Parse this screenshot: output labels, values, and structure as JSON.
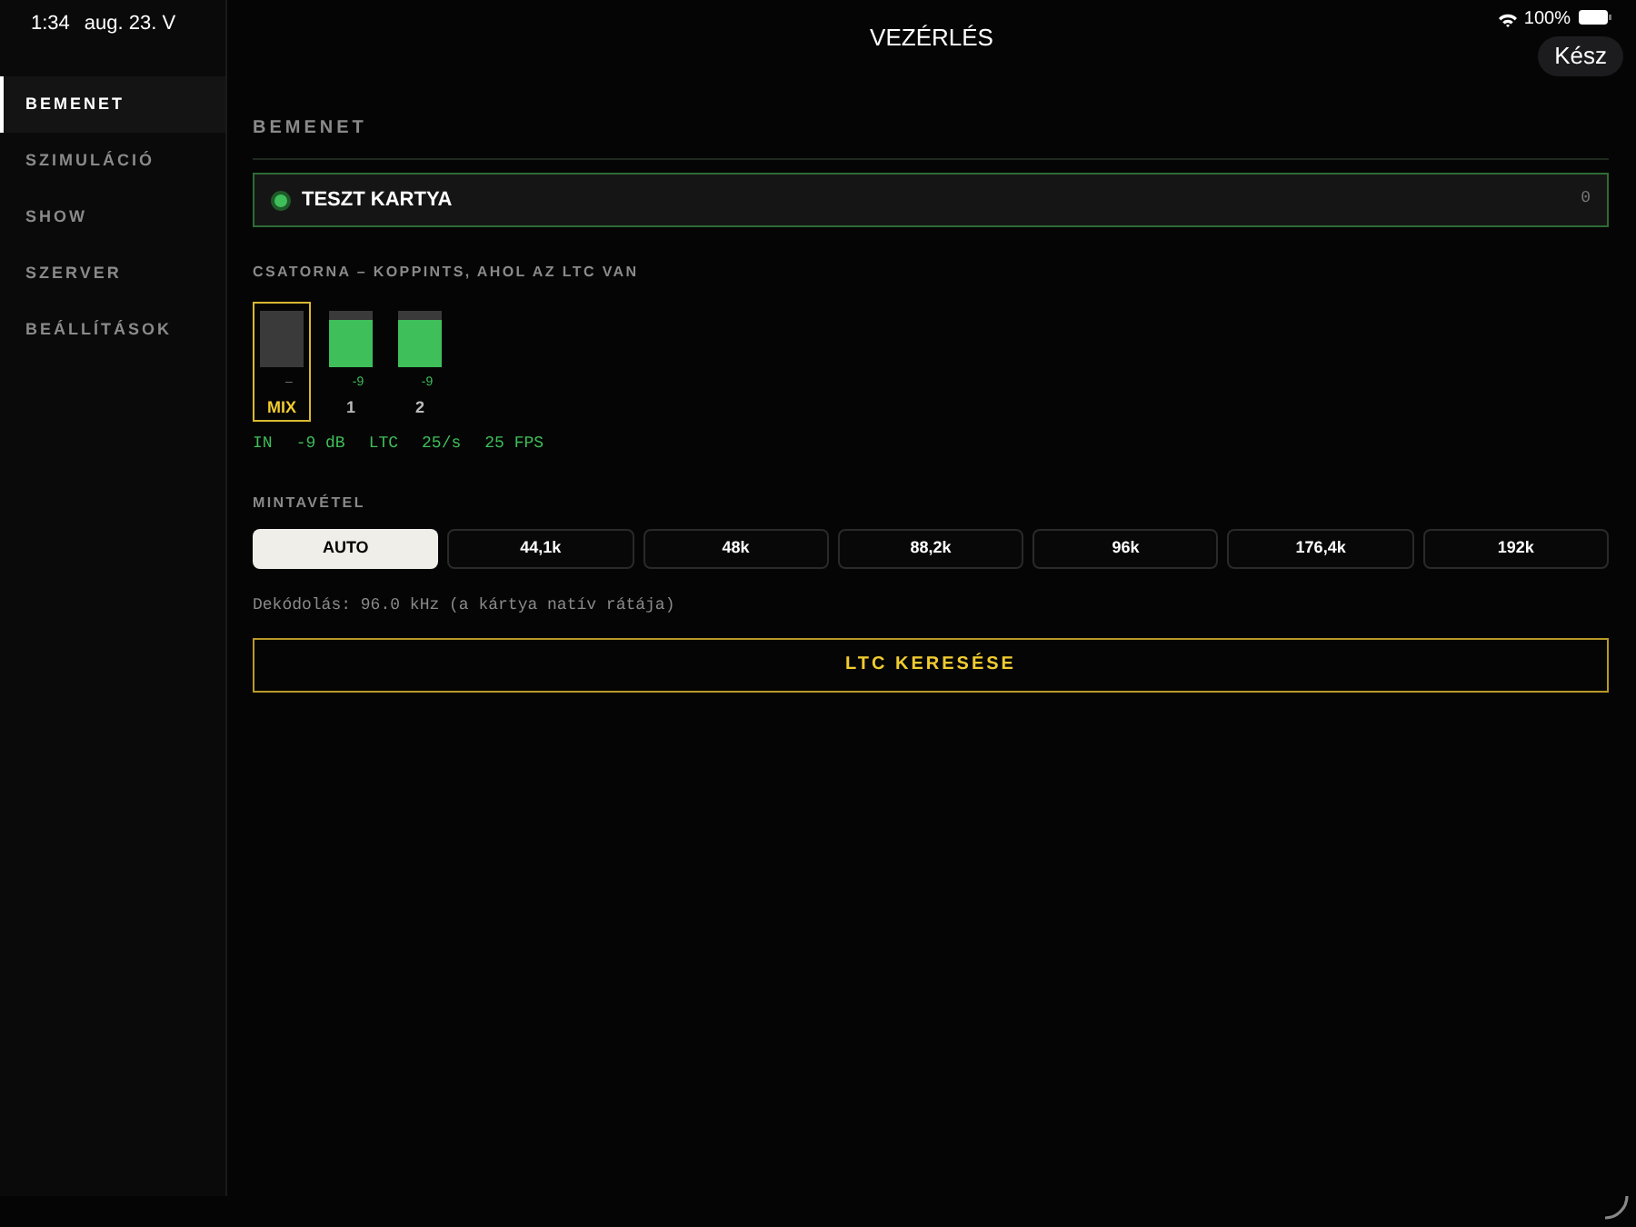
{
  "status_bar": {
    "time": "1:34",
    "date": "aug. 23. V",
    "battery_percent": "100%"
  },
  "window": {
    "title": "VEZÉRLÉS",
    "done_button": "Kész"
  },
  "sidebar": {
    "items": [
      {
        "label": "BEMENET",
        "selected": true
      },
      {
        "label": "SZIMULÁCIÓ",
        "selected": false
      },
      {
        "label": "SHOW",
        "selected": false
      },
      {
        "label": "SZERVER",
        "selected": false
      },
      {
        "label": "BEÁLLÍTÁSOK",
        "selected": false
      }
    ]
  },
  "section_title": "BEMENET",
  "input_card": {
    "label": "TESZT KARTYA",
    "count": "0",
    "active": true
  },
  "channel_heading": "CSATORNA – KOPPINTS, AHOL AZ LTC VAN",
  "channels": [
    {
      "name": "MIX",
      "reading": "–",
      "level": 0,
      "selected": true
    },
    {
      "name": "1",
      "reading": "-9",
      "level": 0.85,
      "selected": false
    },
    {
      "name": "2",
      "reading": "-9",
      "level": 0.85,
      "selected": false
    }
  ],
  "readout": [
    "IN",
    "-9 dB",
    "LTC",
    "25/s",
    "25 FPS"
  ],
  "sampling_heading": "MINTAVÉTEL",
  "sample_rates": [
    {
      "label": "AUTO",
      "selected": true
    },
    {
      "label": "44,1k",
      "selected": false
    },
    {
      "label": "48k",
      "selected": false
    },
    {
      "label": "88,2k",
      "selected": false
    },
    {
      "label": "96k",
      "selected": false
    },
    {
      "label": "176,4k",
      "selected": false
    },
    {
      "label": "192k",
      "selected": false
    }
  ],
  "decode_note": "Dekódolás: 96.0 kHz (a kártya natív rátája)",
  "search_button": "LTC KERESÉSE"
}
